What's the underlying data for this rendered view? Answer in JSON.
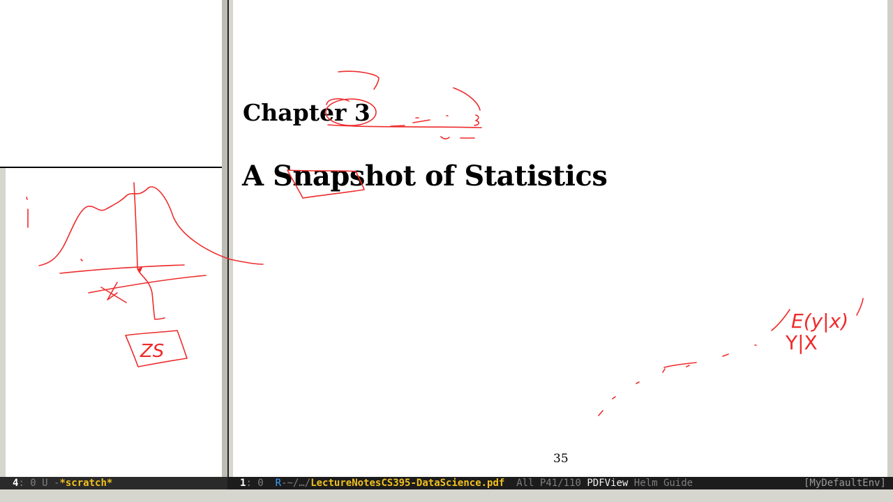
{
  "pdf": {
    "chapter_label": "Chapter 3",
    "chapter_title": "A Snapshot of Statistics",
    "page_number": "35"
  },
  "annotations": {
    "handwriting_1": "E(y|x)",
    "handwriting_2": "Y|X",
    "handwriting_3": "ZS"
  },
  "modeline_left": {
    "window_number": "4",
    "status": ": 0 U -",
    "buffer_name": "*scratch*"
  },
  "modeline_right": {
    "window_number": "1",
    "status": ": 0  ",
    "remote_flag": "R",
    "path_prefix": "-~/…/",
    "buffer_name": "LectureNotesCS395-DataScience.pdf",
    "position": "  All P41/110 ",
    "major_mode": "PDFView",
    "minor_modes": " Helm Guide",
    "env": "[MyDefaultEnv]"
  },
  "colors": {
    "ink_red": "#ee2b2b",
    "buffer_name_yellow": "#f0c020",
    "remote_blue": "#3aa0ff",
    "modeline_bg": "#1c1c1c"
  }
}
